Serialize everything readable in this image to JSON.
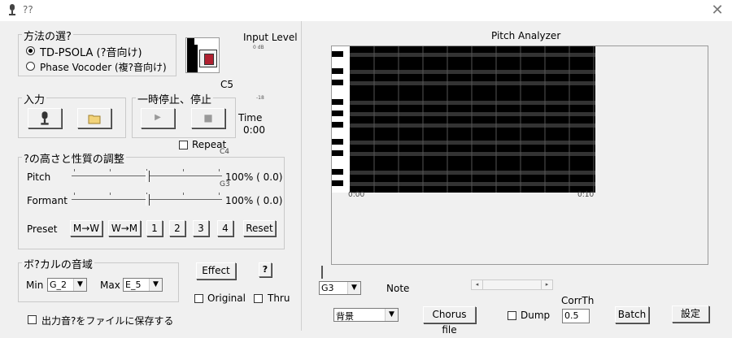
{
  "window": {
    "title": "??"
  },
  "method": {
    "group_label": "方法の選?",
    "option1": "TD-PSOLA (?音向け)",
    "option2": "Phase Vocoder (複?音向け)"
  },
  "input_level": {
    "label": "Input Level",
    "db_top": "0 dB",
    "db_mid": "-18"
  },
  "notes": {
    "c5": "C5",
    "c4": "C4",
    "g3": "G3"
  },
  "input": {
    "group_label": "入力"
  },
  "pause": {
    "group_label": "一時停止、停止",
    "play_glyph": "▶",
    "stop_glyph": "■"
  },
  "time": {
    "label": "Time",
    "value": "0:00"
  },
  "repeat": {
    "label": "Repeat"
  },
  "adjust": {
    "group_label": "?の高さと性質の調整",
    "pitch_label": "Pitch",
    "pitch_value": "100% ( 0.0)",
    "formant_label": "Formant",
    "formant_value": "100% ( 0.0)",
    "preset_label": "Preset",
    "preset_buttons": [
      "M→W",
      "W→M",
      "1",
      "2",
      "3",
      "4",
      "Reset"
    ]
  },
  "vocal": {
    "group_label": "ボ?カルの音域",
    "min_label": "Min",
    "min_value": "G_2",
    "max_label": "Max",
    "max_value": "E_5"
  },
  "effect": {
    "label": "Effect",
    "help_glyph": "?"
  },
  "original": {
    "label": "Original"
  },
  "thru": {
    "label": "Thru"
  },
  "save": {
    "label": "出力音?をファイルに保存する"
  },
  "analyzer": {
    "title": "Pitch Analyzer",
    "time_start": "0:00",
    "time_end": "0:10",
    "note_select": "G3",
    "note_label": "Note",
    "mode_select": "背景",
    "chorus_label": "Chorus file",
    "dump_label": "Dump",
    "corrth_label": "CorrTh",
    "corrth_value": "0.5",
    "batch_label": "Batch",
    "settings_label": "設定"
  }
}
